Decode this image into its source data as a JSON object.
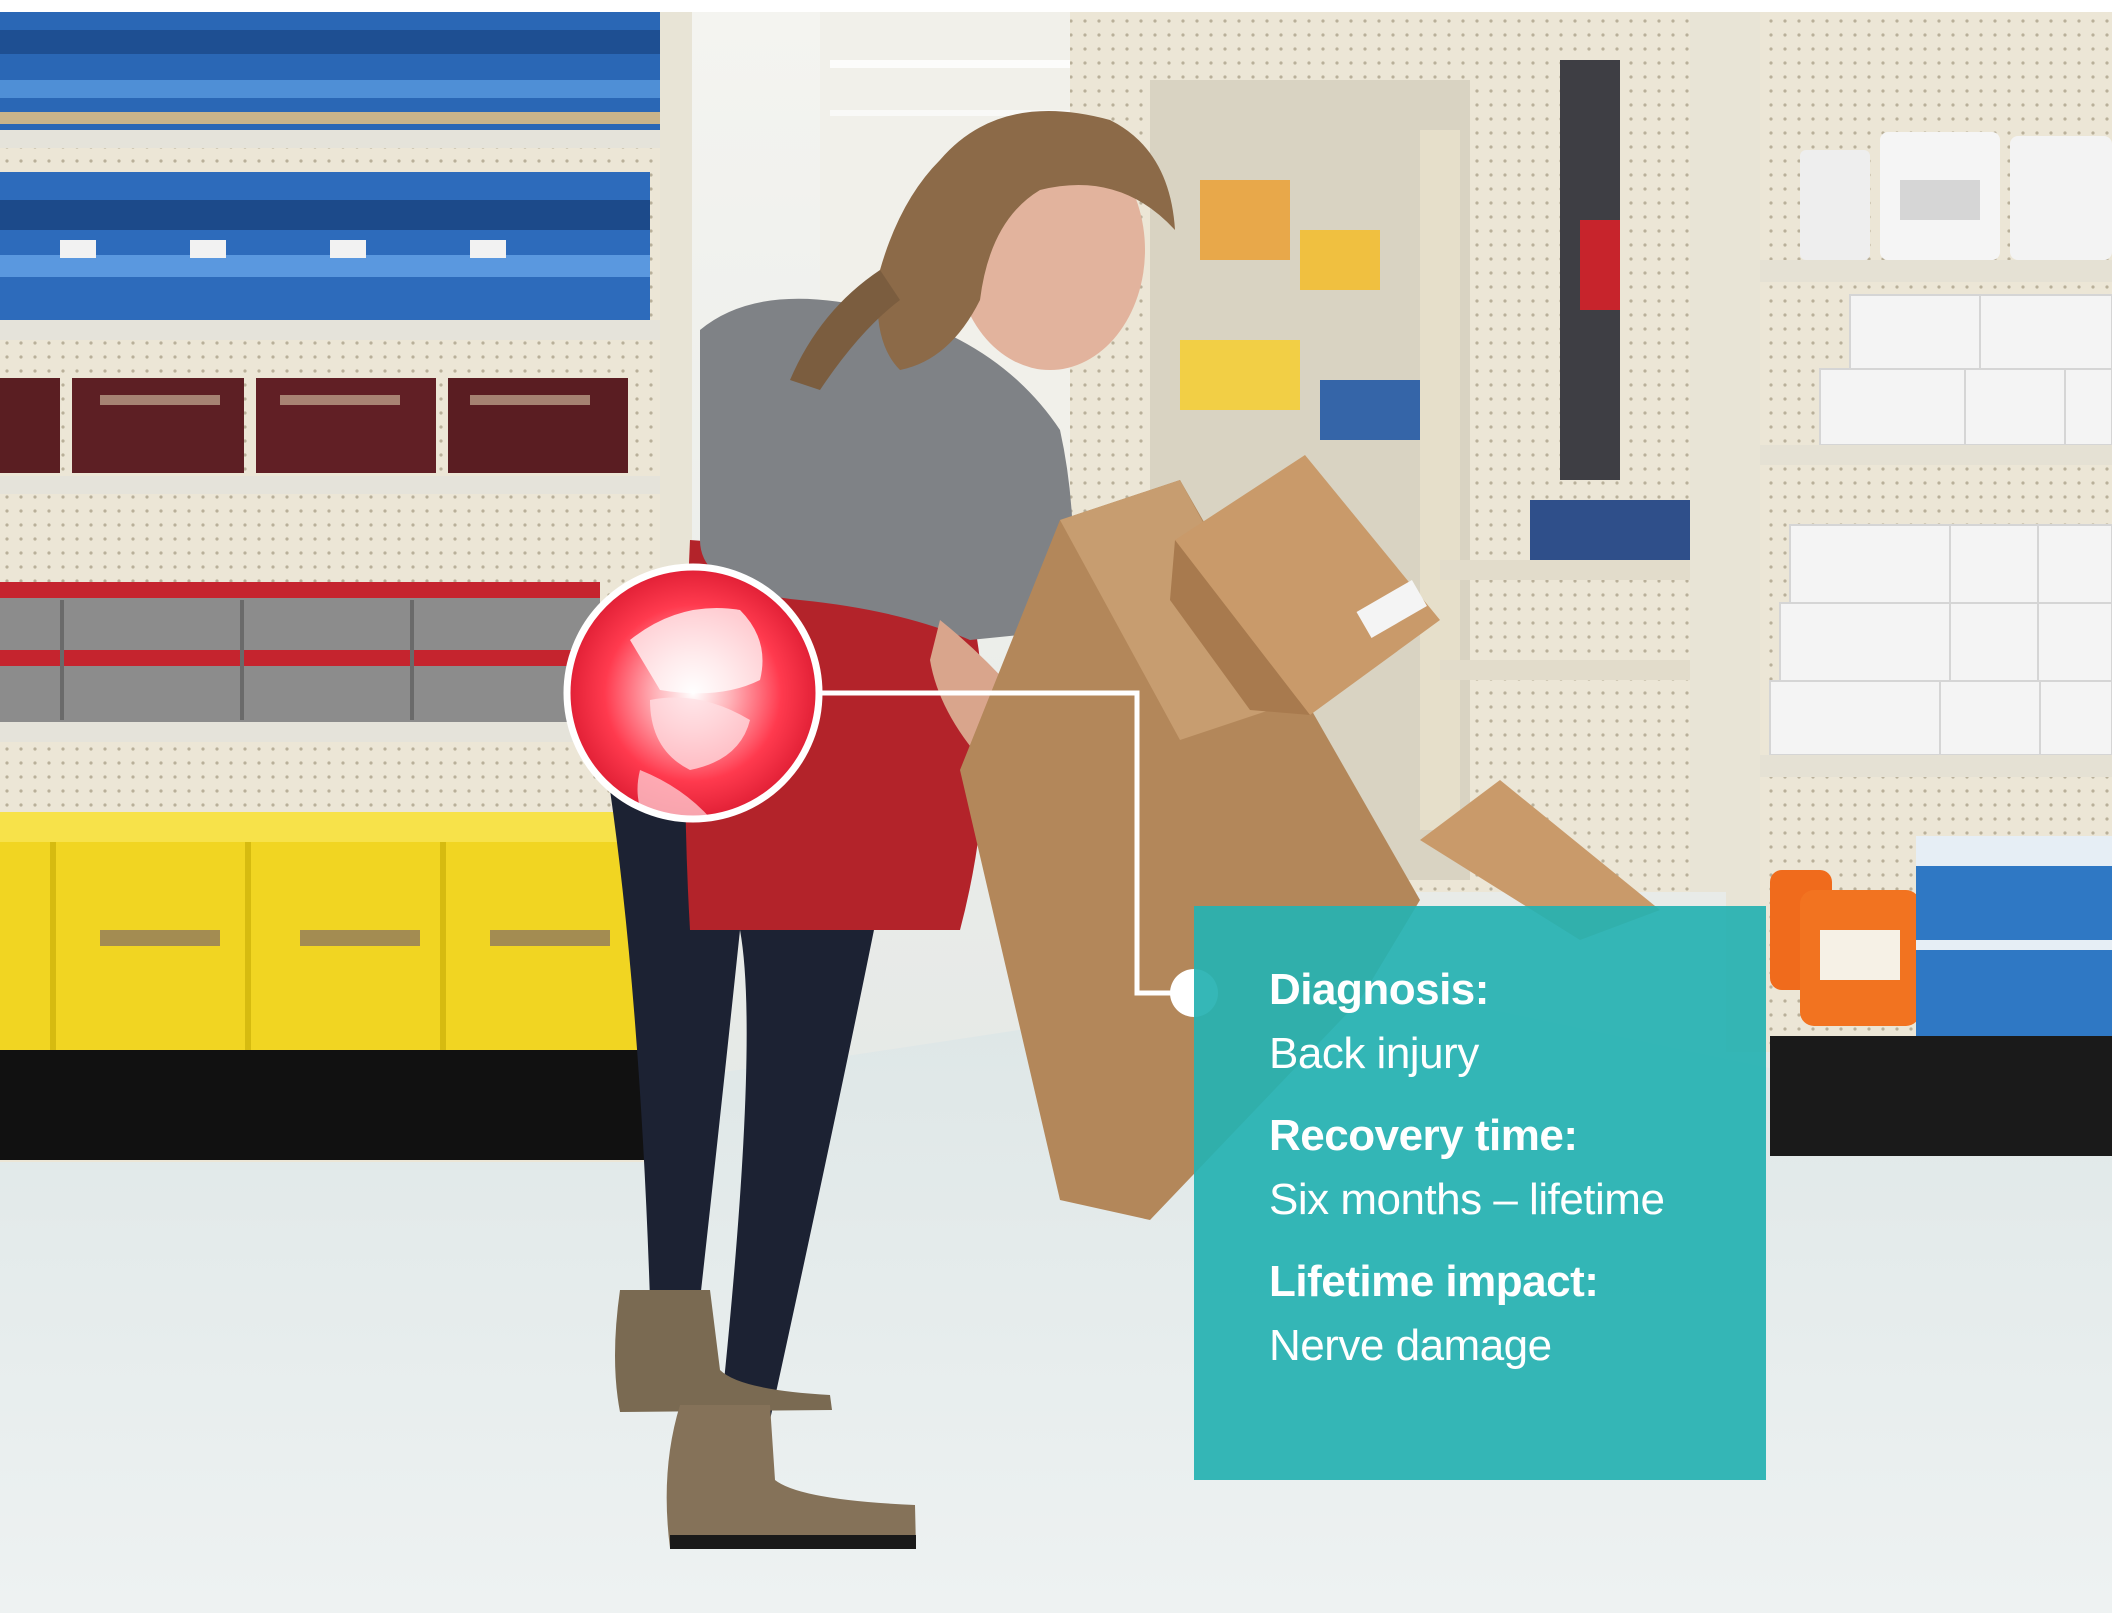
{
  "callout": {
    "items": [
      {
        "label": "Diagnosis:",
        "value": "Back injury"
      },
      {
        "label": "Recovery time:",
        "value": "Six months – lifetime"
      },
      {
        "label": "Lifetime impact:",
        "value": "Nerve damage"
      }
    ]
  },
  "colors": {
    "panel": "#26b2b2",
    "highlight": "#ff3a4e",
    "apron": "#b3232a",
    "floor": "#e6eded"
  },
  "icons": {
    "highlight": "spine-xray-highlight-icon",
    "connector_dot": "connector-dot-icon"
  }
}
